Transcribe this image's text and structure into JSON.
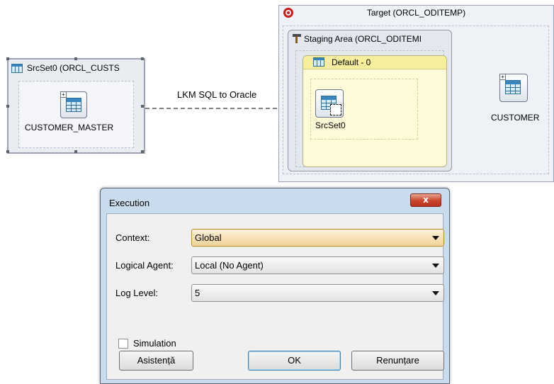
{
  "diagram": {
    "source_set": {
      "title": "SrcSet0 (ORCL_CUSTS",
      "node_label": "CUSTOMER_MASTER"
    },
    "mapping_label": "LKM SQL to Oracle",
    "target": {
      "title": "Target (ORCL_ODITEMP)",
      "staging_title": "Staging Area (ORCL_ODITEMI",
      "default_title": "Default - 0",
      "srcset_node_label": "SrcSet0",
      "customer_node_label": "CUSTOMER"
    }
  },
  "dialog": {
    "title": "Execution",
    "close_label": "x",
    "fields": {
      "context": {
        "label": "Context:",
        "value": "Global"
      },
      "logical_agent": {
        "label": "Logical Agent:",
        "value": "Local (No Agent)"
      },
      "log_level": {
        "label": "Log Level:",
        "value": "5"
      }
    },
    "simulation_label": "Simulation",
    "buttons": {
      "help": "Asistență",
      "ok": "OK",
      "cancel": "Renunțare"
    }
  }
}
